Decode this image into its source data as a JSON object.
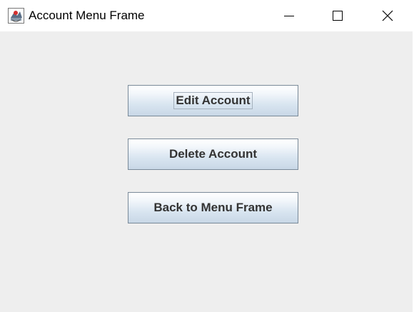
{
  "window": {
    "title": "Account Menu Frame",
    "icon": "java-cup-icon",
    "controls": {
      "minimize": "minimize-icon",
      "maximize": "maximize-icon",
      "close": "close-icon"
    }
  },
  "buttons": {
    "edit_account": "Edit Account",
    "delete_account": "Delete Account",
    "back_to_menu": "Back to Menu Frame"
  },
  "colors": {
    "background": "#eeeeee",
    "button_border": "#7a8a99",
    "button_text": "#333333",
    "java_red": "#d32f2f"
  }
}
